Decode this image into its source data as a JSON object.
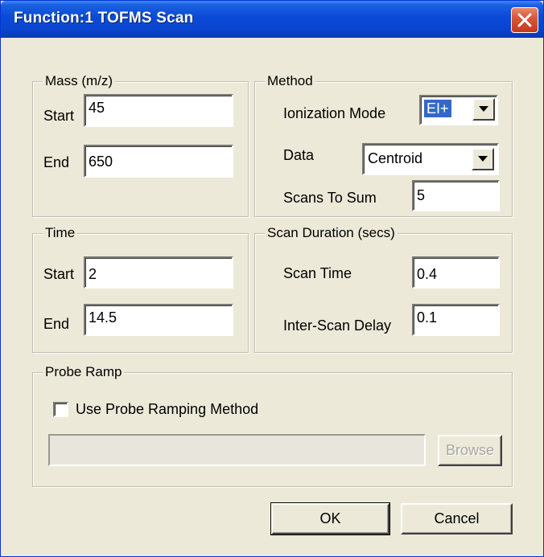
{
  "window": {
    "title": "Function:1 TOFMS Scan"
  },
  "mass": {
    "legend": "Mass (m/z)",
    "start_label": "Start",
    "start_value": "45",
    "end_label": "End",
    "end_value": "650"
  },
  "method": {
    "legend": "Method",
    "ionization_label": "Ionization Mode",
    "ionization_value": "EI+",
    "data_label": "Data",
    "data_value": "Centroid",
    "scans_label": "Scans To Sum",
    "scans_value": "5"
  },
  "time": {
    "legend": "Time",
    "start_label": "Start",
    "start_value": "2",
    "end_label": "End",
    "end_value": "14.5"
  },
  "scan_duration": {
    "legend": "Scan Duration (secs)",
    "scan_time_label": "Scan Time",
    "scan_time_value": "0.4",
    "inter_scan_label": "Inter-Scan Delay",
    "inter_scan_value": "0.1"
  },
  "probe_ramp": {
    "legend": "Probe Ramp",
    "checkbox_label": "Use Probe Ramping Method",
    "checkbox_checked": false,
    "path_value": "",
    "browse_label": "Browse"
  },
  "buttons": {
    "ok_label": "OK",
    "cancel_label": "Cancel"
  },
  "colors": {
    "title_bar": "#0a46cf",
    "dialog_background": "#ece9d8",
    "selection": "#316ac5",
    "close_button": "#c6381a"
  },
  "icons": {
    "close": "close-icon",
    "dropdown": "chevron-down-icon"
  }
}
